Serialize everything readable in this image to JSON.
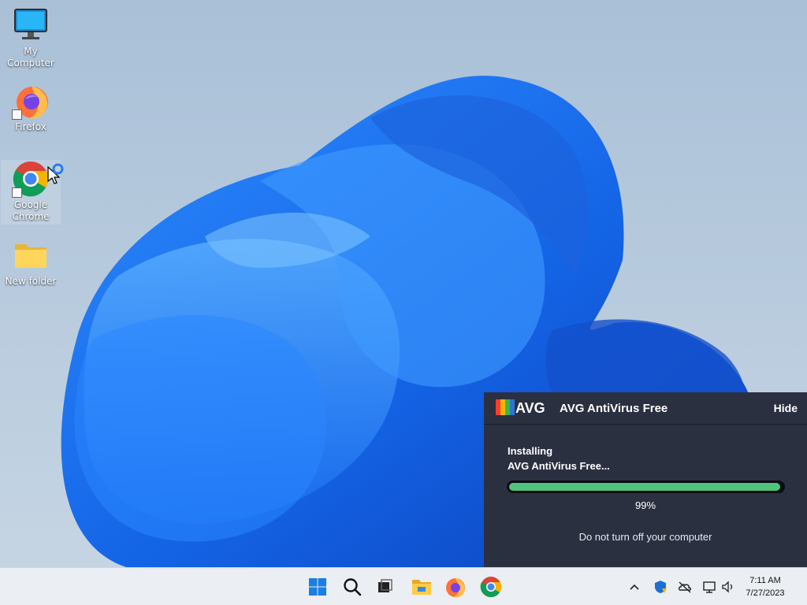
{
  "desktop": {
    "icons": [
      {
        "label": "My Computer",
        "icon": "monitor-icon"
      },
      {
        "label": "Firefox",
        "icon": "firefox-icon"
      },
      {
        "label": "Google Chrome",
        "icon": "chrome-icon"
      },
      {
        "label": "New folder",
        "icon": "folder-icon"
      }
    ]
  },
  "avg": {
    "logo_text": "AVG",
    "title": "AVG AntiVirus Free",
    "hide_label": "Hide",
    "status_line1": "Installing",
    "status_line2": "AVG AntiVirus Free...",
    "progress_percent": 99,
    "progress_label": "99%",
    "warning": "Do not turn off your computer",
    "colors": {
      "panel": "#2b3041",
      "progress": "#4fc27e"
    }
  },
  "taskbar": {
    "apps": [
      "windows-start-icon",
      "search-icon",
      "task-view-icon",
      "file-explorer-icon",
      "firefox-icon",
      "chrome-icon"
    ],
    "tray": [
      "chevron-up-icon",
      "defender-shield-icon",
      "onedrive-offline-icon",
      "network-icon",
      "speaker-icon"
    ],
    "clock": {
      "time": "7:11 AM",
      "date": "7/27/2023"
    }
  }
}
